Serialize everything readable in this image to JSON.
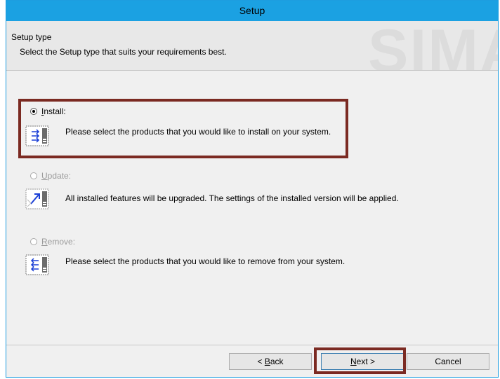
{
  "window": {
    "title": "Setup"
  },
  "header": {
    "title": "Setup type",
    "subtitle": "Select the Setup type that suits your requirements best.",
    "watermark": "SIMA"
  },
  "options": {
    "install": {
      "label": "Install:",
      "selected": true,
      "enabled": true,
      "icon": "install-products-icon",
      "description": "Please select the products that you would like to install on your system."
    },
    "update": {
      "label": "Update:",
      "selected": false,
      "enabled": false,
      "icon": "upgrade-icon",
      "description": "All installed features will be upgraded. The settings of the installed version will be applied."
    },
    "remove": {
      "label": "Remove:",
      "selected": false,
      "enabled": false,
      "icon": "remove-products-icon",
      "description": "Please select the products that you would like to remove from your system."
    }
  },
  "buttons": {
    "back": "< Back",
    "next": "Next >",
    "cancel": "Cancel"
  },
  "colors": {
    "titlebar": "#1ba1e2",
    "highlight": "#7b2a22",
    "window_bg": "#f0f0f0"
  }
}
